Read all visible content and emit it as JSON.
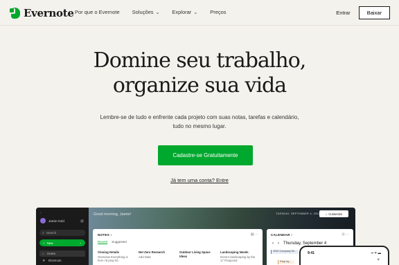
{
  "nav": {
    "brand": "Evernote",
    "links": [
      {
        "label": "Por que o Evernote"
      },
      {
        "label": "Soluções",
        "chevron": "⌄"
      },
      {
        "label": "Explorar",
        "chevron": "⌄"
      },
      {
        "label": "Preços"
      }
    ],
    "signin": "Entrar",
    "download": "Baixar"
  },
  "hero": {
    "title_line1": "Domine seu trabalho,",
    "title_line2": "organize sua vida",
    "subtitle": "Lembre-se de tudo e enfrente cada projeto com suas notas, tarefas e calendário, tudo no mesmo lugar.",
    "cta": "Cadastre-se Gratuitamente",
    "login": "Já tem uma conta? Entre"
  },
  "app": {
    "user": "Jamie Gold",
    "search": "Search",
    "new": "New",
    "sidebar": [
      "Home",
      "Shortcuts"
    ],
    "greeting": "Good morning, Jamie!",
    "date": "TUESDAY, SEPTEMBER 4, 2024",
    "customize": "Customize",
    "notes_title": "NOTES",
    "notes_arrow": "›",
    "notes_actions": "▤ ···",
    "tabs": [
      "Recent",
      "Suggested"
    ],
    "notes": [
      {
        "title": "Closing Details",
        "body": "Overview Everything is here I'd pray for"
      },
      {
        "title": "Net Zero Research",
        "body": "Add Date"
      },
      {
        "title": "Outdoor Living Space Ideas",
        "body": ""
      },
      {
        "title": "Landscaping Needs",
        "body": "Done's landscaping by the 17 Proposed"
      }
    ],
    "calendar_title": "CALENDAR",
    "calendar_actions": "⊡ ···",
    "calendar_day": "Thursday, September 4",
    "calendar_events": [
      "2000 Company Mi...",
      "Drop by..."
    ]
  },
  "phone": {
    "time": "9:41",
    "status": "▪▪ ᯤ ▬",
    "close": "×"
  },
  "colors": {
    "brand_green": "#00a82d",
    "background": "#f4f2ec"
  }
}
